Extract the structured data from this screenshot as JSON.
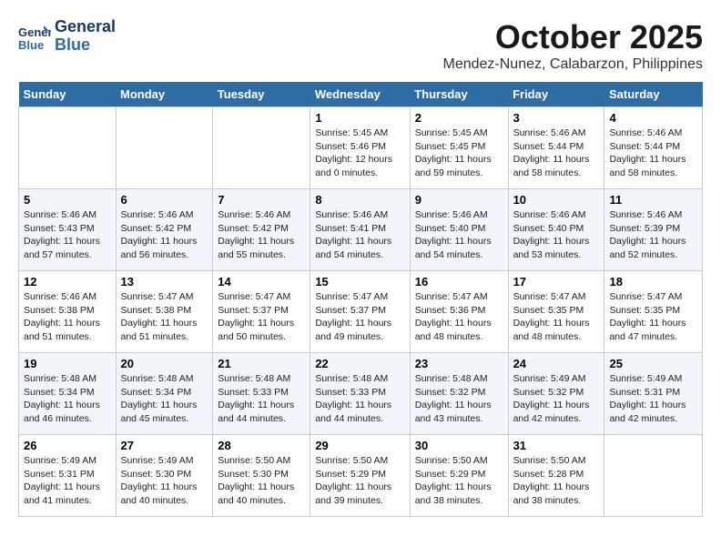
{
  "header": {
    "logo_line1": "General",
    "logo_line2": "Blue",
    "month": "October 2025",
    "location": "Mendez-Nunez, Calabarzon, Philippines"
  },
  "weekdays": [
    "Sunday",
    "Monday",
    "Tuesday",
    "Wednesday",
    "Thursday",
    "Friday",
    "Saturday"
  ],
  "weeks": [
    [
      {
        "day": "",
        "sunrise": "",
        "sunset": "",
        "daylight": ""
      },
      {
        "day": "",
        "sunrise": "",
        "sunset": "",
        "daylight": ""
      },
      {
        "day": "",
        "sunrise": "",
        "sunset": "",
        "daylight": ""
      },
      {
        "day": "1",
        "sunrise": "Sunrise: 5:45 AM",
        "sunset": "Sunset: 5:46 PM",
        "daylight": "Daylight: 12 hours and 0 minutes."
      },
      {
        "day": "2",
        "sunrise": "Sunrise: 5:45 AM",
        "sunset": "Sunset: 5:45 PM",
        "daylight": "Daylight: 11 hours and 59 minutes."
      },
      {
        "day": "3",
        "sunrise": "Sunrise: 5:46 AM",
        "sunset": "Sunset: 5:44 PM",
        "daylight": "Daylight: 11 hours and 58 minutes."
      },
      {
        "day": "4",
        "sunrise": "Sunrise: 5:46 AM",
        "sunset": "Sunset: 5:44 PM",
        "daylight": "Daylight: 11 hours and 58 minutes."
      }
    ],
    [
      {
        "day": "5",
        "sunrise": "Sunrise: 5:46 AM",
        "sunset": "Sunset: 5:43 PM",
        "daylight": "Daylight: 11 hours and 57 minutes."
      },
      {
        "day": "6",
        "sunrise": "Sunrise: 5:46 AM",
        "sunset": "Sunset: 5:42 PM",
        "daylight": "Daylight: 11 hours and 56 minutes."
      },
      {
        "day": "7",
        "sunrise": "Sunrise: 5:46 AM",
        "sunset": "Sunset: 5:42 PM",
        "daylight": "Daylight: 11 hours and 55 minutes."
      },
      {
        "day": "8",
        "sunrise": "Sunrise: 5:46 AM",
        "sunset": "Sunset: 5:41 PM",
        "daylight": "Daylight: 11 hours and 54 minutes."
      },
      {
        "day": "9",
        "sunrise": "Sunrise: 5:46 AM",
        "sunset": "Sunset: 5:40 PM",
        "daylight": "Daylight: 11 hours and 54 minutes."
      },
      {
        "day": "10",
        "sunrise": "Sunrise: 5:46 AM",
        "sunset": "Sunset: 5:40 PM",
        "daylight": "Daylight: 11 hours and 53 minutes."
      },
      {
        "day": "11",
        "sunrise": "Sunrise: 5:46 AM",
        "sunset": "Sunset: 5:39 PM",
        "daylight": "Daylight: 11 hours and 52 minutes."
      }
    ],
    [
      {
        "day": "12",
        "sunrise": "Sunrise: 5:46 AM",
        "sunset": "Sunset: 5:38 PM",
        "daylight": "Daylight: 11 hours and 51 minutes."
      },
      {
        "day": "13",
        "sunrise": "Sunrise: 5:47 AM",
        "sunset": "Sunset: 5:38 PM",
        "daylight": "Daylight: 11 hours and 51 minutes."
      },
      {
        "day": "14",
        "sunrise": "Sunrise: 5:47 AM",
        "sunset": "Sunset: 5:37 PM",
        "daylight": "Daylight: 11 hours and 50 minutes."
      },
      {
        "day": "15",
        "sunrise": "Sunrise: 5:47 AM",
        "sunset": "Sunset: 5:37 PM",
        "daylight": "Daylight: 11 hours and 49 minutes."
      },
      {
        "day": "16",
        "sunrise": "Sunrise: 5:47 AM",
        "sunset": "Sunset: 5:36 PM",
        "daylight": "Daylight: 11 hours and 48 minutes."
      },
      {
        "day": "17",
        "sunrise": "Sunrise: 5:47 AM",
        "sunset": "Sunset: 5:35 PM",
        "daylight": "Daylight: 11 hours and 48 minutes."
      },
      {
        "day": "18",
        "sunrise": "Sunrise: 5:47 AM",
        "sunset": "Sunset: 5:35 PM",
        "daylight": "Daylight: 11 hours and 47 minutes."
      }
    ],
    [
      {
        "day": "19",
        "sunrise": "Sunrise: 5:48 AM",
        "sunset": "Sunset: 5:34 PM",
        "daylight": "Daylight: 11 hours and 46 minutes."
      },
      {
        "day": "20",
        "sunrise": "Sunrise: 5:48 AM",
        "sunset": "Sunset: 5:34 PM",
        "daylight": "Daylight: 11 hours and 45 minutes."
      },
      {
        "day": "21",
        "sunrise": "Sunrise: 5:48 AM",
        "sunset": "Sunset: 5:33 PM",
        "daylight": "Daylight: 11 hours and 44 minutes."
      },
      {
        "day": "22",
        "sunrise": "Sunrise: 5:48 AM",
        "sunset": "Sunset: 5:33 PM",
        "daylight": "Daylight: 11 hours and 44 minutes."
      },
      {
        "day": "23",
        "sunrise": "Sunrise: 5:48 AM",
        "sunset": "Sunset: 5:32 PM",
        "daylight": "Daylight: 11 hours and 43 minutes."
      },
      {
        "day": "24",
        "sunrise": "Sunrise: 5:49 AM",
        "sunset": "Sunset: 5:32 PM",
        "daylight": "Daylight: 11 hours and 42 minutes."
      },
      {
        "day": "25",
        "sunrise": "Sunrise: 5:49 AM",
        "sunset": "Sunset: 5:31 PM",
        "daylight": "Daylight: 11 hours and 42 minutes."
      }
    ],
    [
      {
        "day": "26",
        "sunrise": "Sunrise: 5:49 AM",
        "sunset": "Sunset: 5:31 PM",
        "daylight": "Daylight: 11 hours and 41 minutes."
      },
      {
        "day": "27",
        "sunrise": "Sunrise: 5:49 AM",
        "sunset": "Sunset: 5:30 PM",
        "daylight": "Daylight: 11 hours and 40 minutes."
      },
      {
        "day": "28",
        "sunrise": "Sunrise: 5:50 AM",
        "sunset": "Sunset: 5:30 PM",
        "daylight": "Daylight: 11 hours and 40 minutes."
      },
      {
        "day": "29",
        "sunrise": "Sunrise: 5:50 AM",
        "sunset": "Sunset: 5:29 PM",
        "daylight": "Daylight: 11 hours and 39 minutes."
      },
      {
        "day": "30",
        "sunrise": "Sunrise: 5:50 AM",
        "sunset": "Sunset: 5:29 PM",
        "daylight": "Daylight: 11 hours and 38 minutes."
      },
      {
        "day": "31",
        "sunrise": "Sunrise: 5:50 AM",
        "sunset": "Sunset: 5:28 PM",
        "daylight": "Daylight: 11 hours and 38 minutes."
      },
      {
        "day": "",
        "sunrise": "",
        "sunset": "",
        "daylight": ""
      }
    ]
  ]
}
